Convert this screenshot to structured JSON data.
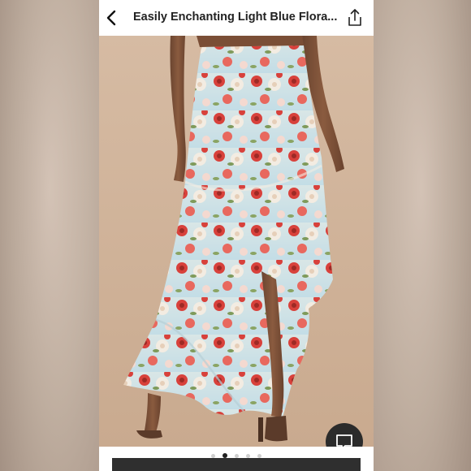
{
  "header": {
    "title": "Easily Enchanting Light Blue Flora...",
    "back_icon": "chevron-left-icon",
    "share_icon": "share-icon"
  },
  "gallery": {
    "image_description_icon": "product-photo",
    "dot_count": 5,
    "active_index": 1
  },
  "chat": {
    "icon": "chat-bubble-icon"
  },
  "colors": {
    "page_bg": "#ffffff",
    "text": "#222222",
    "chat_button": "#2b2b2b",
    "dot_active": "#222222",
    "dot_inactive": "#cfcfcf",
    "skirt_base": "#cfe3e8",
    "flower_red": "#d8413b",
    "flower_cream": "#f3ece2",
    "backdrop": "#d0b39b"
  }
}
